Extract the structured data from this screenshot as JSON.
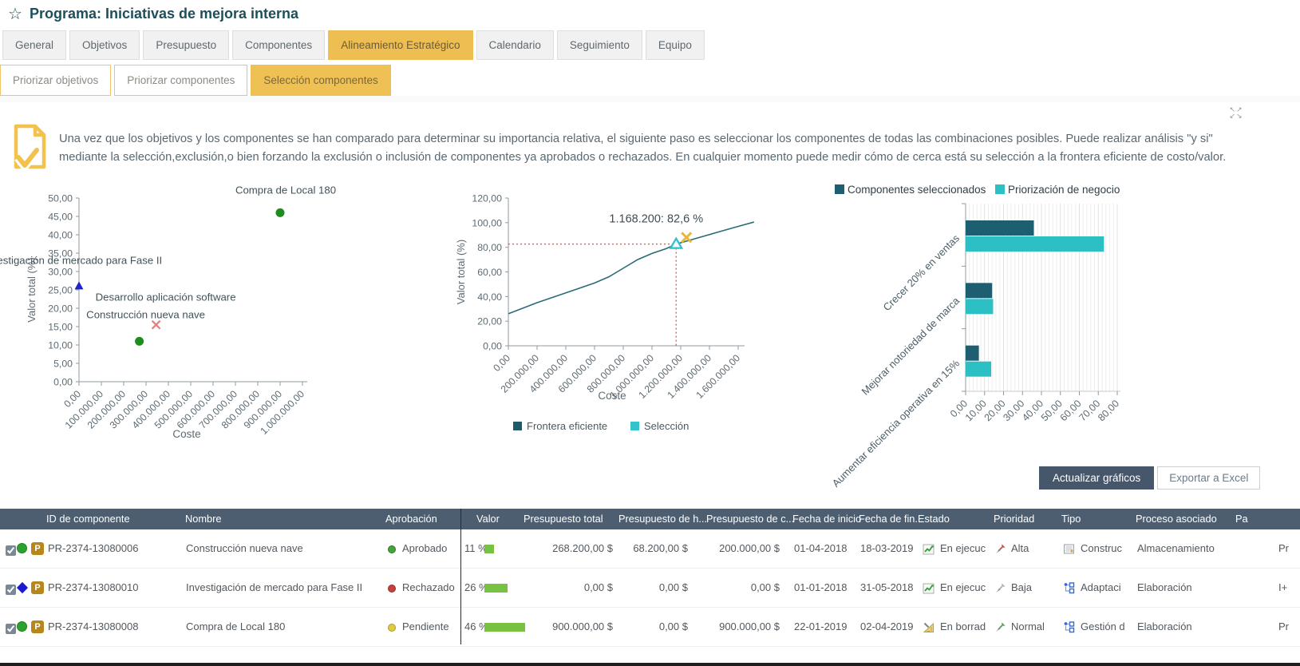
{
  "window": {
    "star": "☆",
    "title": "Programa: Iniciativas de mejora interna"
  },
  "tabs": {
    "items": [
      "General",
      "Objetivos",
      "Presupuesto",
      "Componentes",
      "Alineamiento Estratégico",
      "Calendario",
      "Seguimiento",
      "Equipo"
    ],
    "active": "Alineamiento Estratégico"
  },
  "subtabs": {
    "items": [
      "Priorizar objetivos",
      "Priorizar componentes",
      "Selección componentes"
    ],
    "active": "Selección componentes"
  },
  "icons": {
    "expand": [
      "↖",
      "↗",
      "↙",
      "↘"
    ],
    "info_icon": "document-check"
  },
  "description": {
    "line1": "Una vez que los objetivos y los componentes se han comparado para determinar su importancia relativa, el siguiente paso es seleccionar los componentes de todas las combinaciones posibles. Puede realizar análisis \"y si\"",
    "line2": "mediante la selección,exclusión,o bien forzando la exclusión o inclusión de componentes ya aprobados o rechazados. En cualquier momento puede medir cómo de cerca está su selección a la frontera eficiente de costo/valor."
  },
  "actions": {
    "update_charts": "Actualizar gráficos",
    "export_excel": "Exportar a Excel"
  },
  "colors": {
    "accent_amber": "#efbe53",
    "title_teal": "#1d4f5b",
    "header_bg": "#4e5e71",
    "dark_teal_series": "#1d5f70",
    "cyan_series": "#2cc0c4",
    "frontier_line": "#2a6b78",
    "crosshair_red": "#d96a6a",
    "green_marker": "#1f8c1f",
    "blue_marker": "#2222cc",
    "red_x_marker": "#dd8181",
    "value_bar_green": "#79c143",
    "button_dark": "#46566b"
  },
  "chart_data": [
    {
      "type": "scatter",
      "xlabel": "Coste",
      "ylabel": "Valor total (%)",
      "xlim": [
        0,
        1000000
      ],
      "xtick_step": 100000,
      "ylim": [
        0,
        50
      ],
      "ytick_step": 5,
      "grid": false,
      "points": [
        {
          "label": "Compra de Local 180",
          "x": 900000,
          "y": 46,
          "marker": "circle",
          "color": "#1f8c1f",
          "label_dx": 7,
          "label_dy": -24
        },
        {
          "label": "Investigación de mercado para Fase II",
          "x": 0,
          "y": 26,
          "marker": "triangle",
          "color": "#2222cc",
          "label_dx": -8,
          "label_dy": -28
        },
        {
          "label": "Desarrollo aplicación software",
          "x": 345000,
          "y": 15.5,
          "marker": "x",
          "color": "#dd8181",
          "label_dx": 12,
          "label_dy": -30
        },
        {
          "label": "Construcción nueva nave",
          "x": 270000,
          "y": 11,
          "marker": "circle",
          "color": "#1f8c1f",
          "label_dx": 8,
          "label_dy": -29
        }
      ]
    },
    {
      "type": "line",
      "xlabel": "Coste",
      "ylabel": "Valor total (%)",
      "xlim": [
        0,
        1600000
      ],
      "xtick_step": 200000,
      "ylim": [
        0,
        120
      ],
      "ytick_step": 20,
      "grid": false,
      "legend": [
        {
          "label": "Frontera eficiente",
          "color": "#1d5c66"
        },
        {
          "label": "Selección",
          "color": "#35c2cb"
        }
      ],
      "series": [
        {
          "name": "Frontera eficiente",
          "color": "#2a6b78",
          "points": [
            [
              0,
              26
            ],
            [
              200000,
              35
            ],
            [
              400000,
              43
            ],
            [
              600000,
              51
            ],
            [
              700000,
              56
            ],
            [
              800000,
              63
            ],
            [
              900000,
              70
            ],
            [
              1000000,
              75
            ],
            [
              1100000,
              79
            ],
            [
              1168200,
              82.6
            ],
            [
              1300000,
              87
            ],
            [
              1450000,
              92
            ],
            [
              1600000,
              97
            ],
            [
              1710000,
              100.5
            ]
          ]
        }
      ],
      "selection_marker": {
        "x": 1168200,
        "y": 82.6,
        "color": "#2fc0ca"
      },
      "extra_marker": {
        "x": 1240000,
        "y": 88,
        "marker": "x",
        "color": "#e9b83b"
      },
      "annotation": {
        "text": "1.168.200: 82,6 %",
        "x": 1168200,
        "y": 82.6
      },
      "crosshair_color": "#d96a6a"
    },
    {
      "type": "bar",
      "orientation": "horizontal",
      "categories": [
        "Crecer 20% en ventas",
        "Mejorar notoriedad de marca",
        "Aumentar eficiencia operativa en 15%"
      ],
      "series": [
        {
          "name": "Componentes seleccionados",
          "color": "#1d5f70",
          "values": [
            36,
            14,
            7
          ]
        },
        {
          "name": "Priorización de negocio",
          "color": "#2cc0c4",
          "values": [
            73,
            14.5,
            13.5
          ]
        }
      ],
      "xlim": [
        0,
        80
      ],
      "xtick_step": 10,
      "grid": true,
      "legend_position": "top"
    }
  ],
  "table": {
    "headers": [
      "ID de componente",
      "Nombre",
      "Aprobación",
      "Valor",
      "Presupuesto total",
      "Presupuesto de h...",
      "Presupuesto de c...",
      "Fecha de inicio",
      "Fecha de fin...",
      "Estado",
      "Prioridad",
      "Tipo",
      "Proceso asociado",
      "Pa"
    ],
    "rows": [
      {
        "checked": true,
        "health": "circle-green",
        "badge": "P",
        "id": "PR-2374-13080006",
        "name": "Construcción nueva nave",
        "approval": {
          "label": "Aprobado",
          "state": "approved"
        },
        "value_pct": "11 %",
        "value": 11,
        "budget_total": "268.200,00 $",
        "budget_hours": "68.200,00 $",
        "budget_costs": "200.000,00 $",
        "start": "01-04-2018",
        "end": "18-03-2019",
        "status": {
          "label": "En ejecuc",
          "icon": "chart-up"
        },
        "priority": {
          "label": "Alta",
          "level": "high"
        },
        "type": {
          "label": "Construc",
          "icon": "doc"
        },
        "process": "Almacenamiento",
        "pa": "Pr"
      },
      {
        "checked": true,
        "health": "diamond-blue",
        "badge": "P",
        "id": "PR-2374-13080010",
        "name": "Investigación de mercado para Fase II",
        "approval": {
          "label": "Rechazado",
          "state": "rejected"
        },
        "value_pct": "26 %",
        "value": 26,
        "budget_total": "0,00 $",
        "budget_hours": "0,00 $",
        "budget_costs": "0,00 $",
        "start": "01-01-2018",
        "end": "31-05-2018",
        "status": {
          "label": "En ejecuc",
          "icon": "chart-up"
        },
        "priority": {
          "label": "Baja",
          "level": "low"
        },
        "type": {
          "label": "Adaptaci",
          "icon": "org"
        },
        "process": "Elaboración",
        "pa": "I+"
      },
      {
        "checked": true,
        "health": "circle-green",
        "badge": "P",
        "id": "PR-2374-13080008",
        "name": "Compra de Local 180",
        "approval": {
          "label": "Pendiente",
          "state": "pending"
        },
        "value_pct": "46 %",
        "value": 46,
        "budget_total": "900.000,00 $",
        "budget_hours": "0,00 $",
        "budget_costs": "900.000,00 $",
        "start": "22-01-2019",
        "end": "02-04-2019",
        "status": {
          "label": "En borrad",
          "icon": "draft"
        },
        "priority": {
          "label": "Normal",
          "level": "normal"
        },
        "type": {
          "label": "Gestión d",
          "icon": "org"
        },
        "process": "Elaboración",
        "pa": "Pr"
      }
    ]
  }
}
